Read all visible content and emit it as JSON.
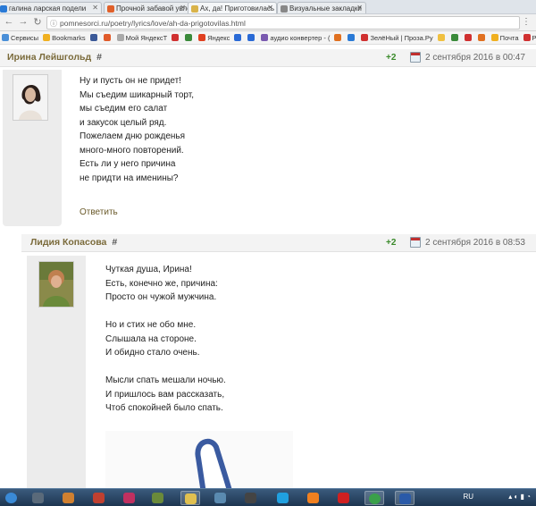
{
  "browser": {
    "tabs": [
      {
        "label": "галина ларская подели",
        "color": "#2a7ad6",
        "active": false
      },
      {
        "label": "Прочной забавой увле",
        "color": "#e0602a",
        "active": false
      },
      {
        "label": "Ах, да! Приготовилась",
        "color": "#d9b34a",
        "active": true
      },
      {
        "label": "Визуальные закладки",
        "color": "#888888",
        "active": false
      }
    ],
    "url": "pomnesorci.ru/poetry/lyrics/love/ah-da-prigotovilas.html"
  },
  "bookmarks": [
    {
      "label": "Сервисы",
      "color": "#4a8fd8"
    },
    {
      "label": "Bookmarks",
      "color": "#f0b020"
    },
    {
      "label": "",
      "color": "#3b5998"
    },
    {
      "label": "",
      "color": "#e05a2a"
    },
    {
      "label": "Мой ЯндексТ",
      "color": "#aaaaaa"
    },
    {
      "label": "",
      "color": "#d03030"
    },
    {
      "label": "",
      "color": "#3a8a3a"
    },
    {
      "label": "Яндекс",
      "color": "#e04020"
    },
    {
      "label": "",
      "color": "#2a6ad6"
    },
    {
      "label": "",
      "color": "#2a6ad6"
    },
    {
      "label": "аудио конвертер - (",
      "color": "#7a5ab0"
    },
    {
      "label": "",
      "color": "#e07020"
    },
    {
      "label": "",
      "color": "#2a7ad6"
    },
    {
      "label": "ЗелёНый | Проза.Ру",
      "color": "#d03030"
    },
    {
      "label": "",
      "color": "#f0c040"
    },
    {
      "label": "",
      "color": "#3a8a3a"
    },
    {
      "label": "",
      "color": "#d03030"
    },
    {
      "label": "",
      "color": "#e07020"
    },
    {
      "label": "Почта",
      "color": "#f0b020"
    },
    {
      "label": "РСН",
      "color": "#d03030"
    }
  ],
  "comments": [
    {
      "author": "Ирина Лейшгольд",
      "hash": "#",
      "rating": "+2",
      "date": "2 сентября 2016 в 00:47",
      "lines": [
        "Ну и пусть он не придет!",
        "Мы съедим шикарный торт,",
        "мы съедим его салат",
        "и закусок целый ряд.",
        "Пожелаем дню рожденья",
        "много-много повторений.",
        "Есть ли у него причина",
        "не придти на именины?"
      ],
      "reply_label": "Ответить"
    },
    {
      "author": "Лидия Копасова",
      "hash": "#",
      "rating": "+2",
      "date": "2 сентября 2016 в 08:53",
      "lines": [
        "Чуткая душа, Ирина!",
        "Есть, конечно же, причина:",
        "Просто он чужой мужчина.",
        "",
        "Но и стих не обо мне.",
        "Слышала на стороне.",
        "И обидно стало очень.",
        "",
        "Мысли спать мешали ночью.",
        "И пришлось вам рассказать,",
        "Чтоб спокойней было спать."
      ]
    }
  ],
  "taskbar": {
    "icons": [
      {
        "name": "start-icon",
        "color": "#3a8ad6"
      },
      {
        "name": "media-icon",
        "color": "#5a6a7a"
      },
      {
        "name": "paint-icon",
        "color": "#d08030"
      },
      {
        "name": "photo-icon",
        "color": "#c04030"
      },
      {
        "name": "video-icon",
        "color": "#c03060"
      },
      {
        "name": "tool-icon",
        "color": "#6a8a3a"
      },
      {
        "name": "folder-icon",
        "color": "#e0c050"
      },
      {
        "name": "chart-app-icon",
        "color": "#5a8ab0"
      },
      {
        "name": "pen-icon",
        "color": "#444444"
      },
      {
        "name": "skype-icon",
        "color": "#20a0e0"
      },
      {
        "name": "vlc-icon",
        "color": "#f08020"
      },
      {
        "name": "yandex-browser-icon",
        "color": "#d02020"
      },
      {
        "name": "chrome-icon",
        "color": "#3aa04a"
      },
      {
        "name": "word-icon",
        "color": "#2a5aa8"
      }
    ],
    "language": "RU"
  }
}
